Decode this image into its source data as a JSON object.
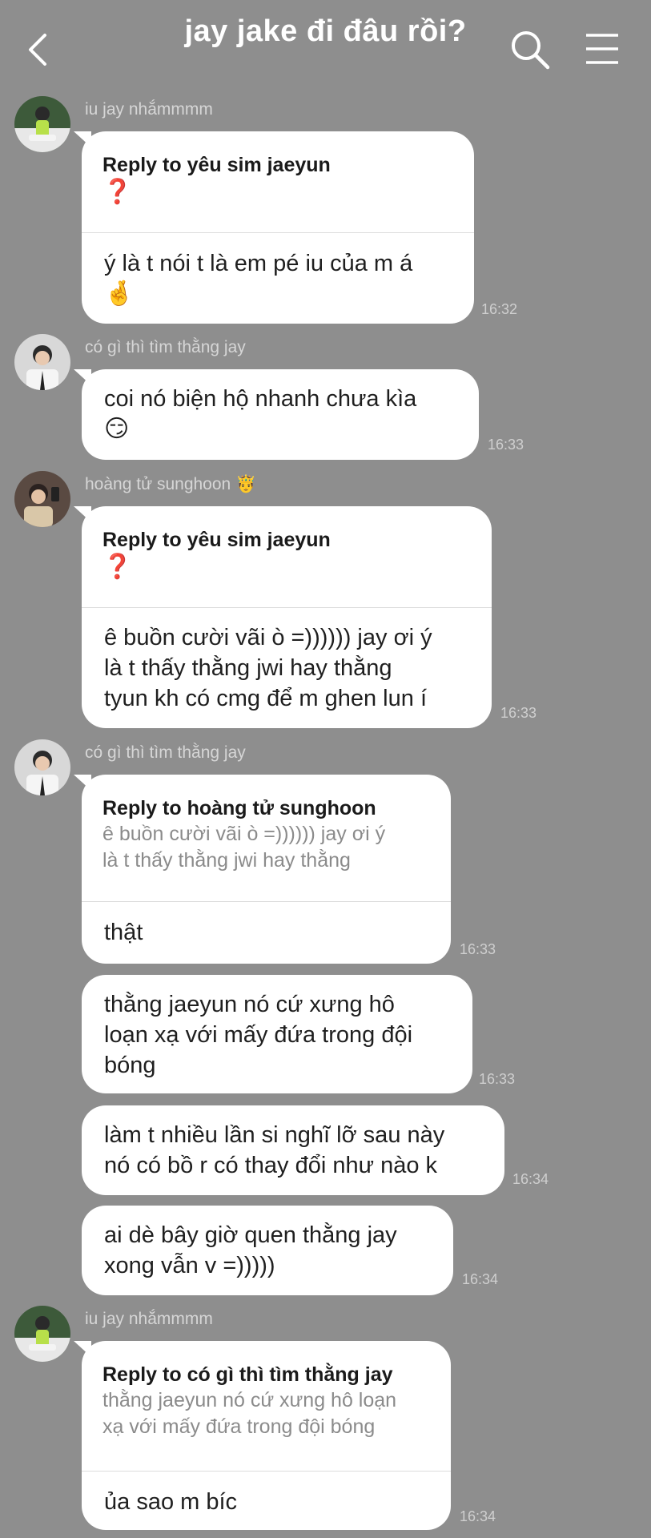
{
  "header": {
    "title": "jay jake đi đâu rồi?"
  },
  "messages": [
    {
      "sender": "iu jay nhắmmmm",
      "reply_to": "Reply to yêu sim jaeyun",
      "reply_mark": "❓",
      "text": "ý là t nói t là em pé iu của m á",
      "emoji": "🤞",
      "time": "16:32"
    },
    {
      "sender": "có gì thì tìm thằng jay",
      "text": "coi nó biện hộ nhanh chưa kìa",
      "emoji": "😏",
      "time": "16:33"
    },
    {
      "sender": "hoàng tử sunghoon",
      "sender_emoji": "🤴",
      "reply_to": "Reply to yêu sim jaeyun",
      "reply_mark": "❓",
      "text_lines": [
        "ê buồn cười vãi ò =)))))) jay ơi ý",
        "là t thấy thằng jwi hay thằng",
        "tyun kh có cmg để m ghen lun í"
      ],
      "time": "16:33"
    },
    {
      "sender": "có gì thì tìm thằng jay",
      "reply_to": "Reply to hoàng tử sunghoon",
      "reply_quote_lines": [
        "ê buồn cười vãi ò =)))))) jay ơi ý",
        "là t thấy thằng jwi hay thằng"
      ],
      "text": "thật",
      "time": "16:33"
    },
    {
      "text_lines": [
        "thằng jaeyun nó cứ xưng hô",
        "loạn xạ với mấy đứa trong đội",
        "bóng"
      ],
      "time": "16:33"
    },
    {
      "text_lines": [
        "làm t nhiều lần si nghĩ lỡ sau này",
        "nó có bồ r có thay đổi như nào k"
      ],
      "time": "16:34"
    },
    {
      "text_lines": [
        "ai dè bây giờ quen thằng jay",
        "xong vẫn v =)))))"
      ],
      "time": "16:34"
    },
    {
      "sender": "iu jay nhắmmmm",
      "reply_to": "Reply to có gì thì tìm thằng jay",
      "reply_quote_lines": [
        "thằng jaeyun nó cứ xưng hô loạn",
        "xạ với mấy đứa trong đội bóng"
      ],
      "text": "ủa sao m bíc",
      "time": "16:34"
    }
  ],
  "colors": {
    "background": "#8e8e8e",
    "bubble": "#ffffff",
    "reply_mark": "#c41e2a"
  },
  "icons": [
    "back-arrow-icon",
    "search-icon",
    "menu-icon"
  ]
}
